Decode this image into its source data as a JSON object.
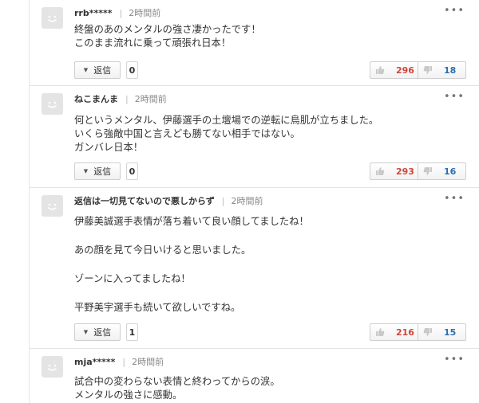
{
  "ui": {
    "reply_label": "返信",
    "separator": "|",
    "more": "•••"
  },
  "comments": [
    {
      "user": "rrb*****",
      "time": "2時間前",
      "lines": [
        "終盤のあのメンタルの強さ凄かったです！",
        "このまま流れに乗って頑張れ日本！"
      ],
      "replies": "0",
      "likes": "296",
      "dislikes": "18"
    },
    {
      "user": "ねこまんま",
      "time": "2時間前",
      "lines": [
        "何というメンタル、伊藤選手の土壇場での逆転に鳥肌が立ちました。",
        "いくら強敵中国と言えども勝てない相手ではない。",
        "ガンバレ日本！"
      ],
      "replies": "0",
      "likes": "293",
      "dislikes": "16"
    },
    {
      "user": "返信は一切見てないので悪しからず",
      "time": "2時間前",
      "lines": [
        "伊藤美誠選手表情が落ち着いて良い顔してましたね！",
        "",
        "あの顔を見て今日いけると思いました。",
        "",
        "ゾーンに入ってましたね！",
        "",
        "平野美宇選手も続いて欲しいですね。"
      ],
      "replies": "1",
      "likes": "216",
      "dislikes": "15"
    },
    {
      "user": "mja*****",
      "time": "2時間前",
      "lines": [
        "試合中の変わらない表情と終わってからの涙。",
        "メンタルの強さに感動。"
      ]
    }
  ],
  "icons": {
    "avatar": "default-smiley-avatar-icon",
    "thumbs_up": "thumbs-up-icon",
    "thumbs_down": "thumbs-down-icon",
    "more": "more-options-icon",
    "reply_toggle": "triangle-down-icon"
  },
  "colors": {
    "likes": "#d0453a",
    "dislikes": "#2a6db3",
    "avatar_bg": "#e4e4e4"
  }
}
